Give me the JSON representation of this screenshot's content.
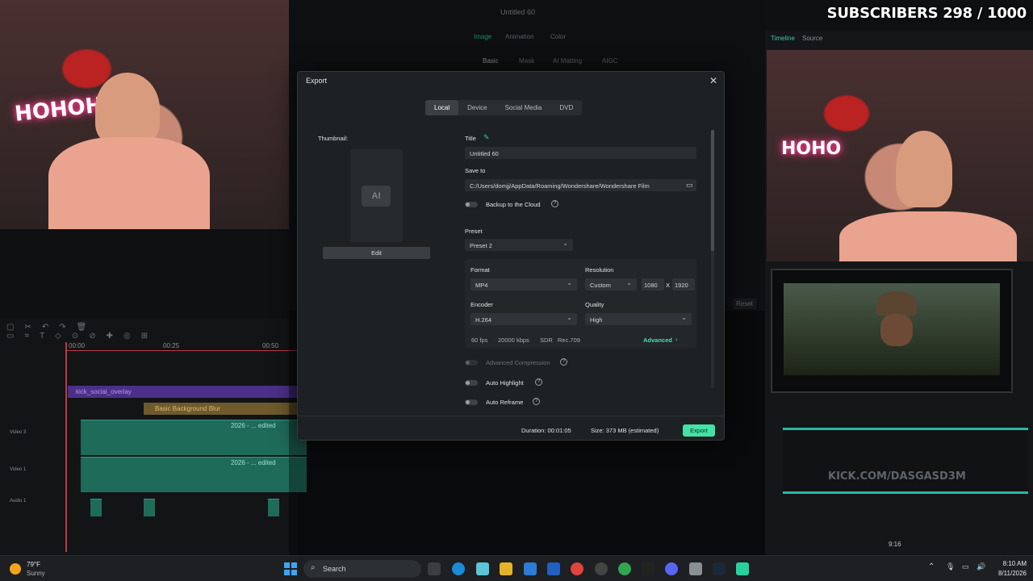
{
  "overlay": {
    "subscribers": "SUBSCRIBERS 298 / 1000",
    "kick_url": "KICK.COM/DASGASD3M"
  },
  "editor": {
    "window_title": "Untitled 60",
    "props_tabs": [
      "Image",
      "Animation",
      "Color"
    ],
    "sub_tabs": [
      "Basic",
      "Mask",
      "AI Matting",
      "AIGC"
    ],
    "right_tabs": [
      "Timeline",
      "Source"
    ],
    "reset_label": "Reset",
    "timecodes": [
      "00:00",
      "00:25",
      "00:50"
    ],
    "tracks": {
      "social_overlay": "kick_social_overlay",
      "bg_blur": "Basic Background Blur",
      "clip_a": "2026 - ... edited",
      "clip_b": "2026 - ... edited"
    },
    "track_labels": [
      "Video 3",
      "Video 1",
      "Audio 1"
    ],
    "preview_time": "9:16"
  },
  "export_dialog": {
    "title": "Export",
    "tabs": [
      "Local",
      "Device",
      "Social Media",
      "DVD"
    ],
    "active_tab": "Local",
    "thumbnail_label": "Thumbnail:",
    "thumbnail_ai": "AI",
    "edit_label": "Edit",
    "title_label": "Title",
    "title_value": "Untitled 60",
    "save_to_label": "Save to",
    "save_to_value": "C:/Users/domjj/AppData/Roaming/Wondershare/Wondershare Film",
    "backup_label": "Backup to the Cloud",
    "preset_label": "Preset",
    "preset_value": "Preset 2",
    "format_label": "Format",
    "format_value": "MP4",
    "resolution_label": "Resolution",
    "resolution_mode": "Custom",
    "res_w": "1080",
    "res_x": "X",
    "res_h": "1920",
    "encoder_label": "Encoder",
    "encoder_value": "H.264",
    "quality_label": "Quality",
    "quality_value": "High",
    "specs": [
      "60 fps",
      "20000 kbps",
      "SDR",
      "Rec.709"
    ],
    "advanced_label": "Advanced",
    "adv_compression": "Advanced Compression",
    "auto_highlight": "Auto Highlight",
    "auto_reframe": "Auto Reframe",
    "duration": "Duration: 00:01:05",
    "size": "Size: 373 MB (estimated)",
    "export_label": "Export"
  },
  "taskbar": {
    "weather_temp": "79°F",
    "weather_desc": "Sunny",
    "search_placeholder": "Search",
    "time": "8:10 AM",
    "date": "8/11/2026"
  }
}
